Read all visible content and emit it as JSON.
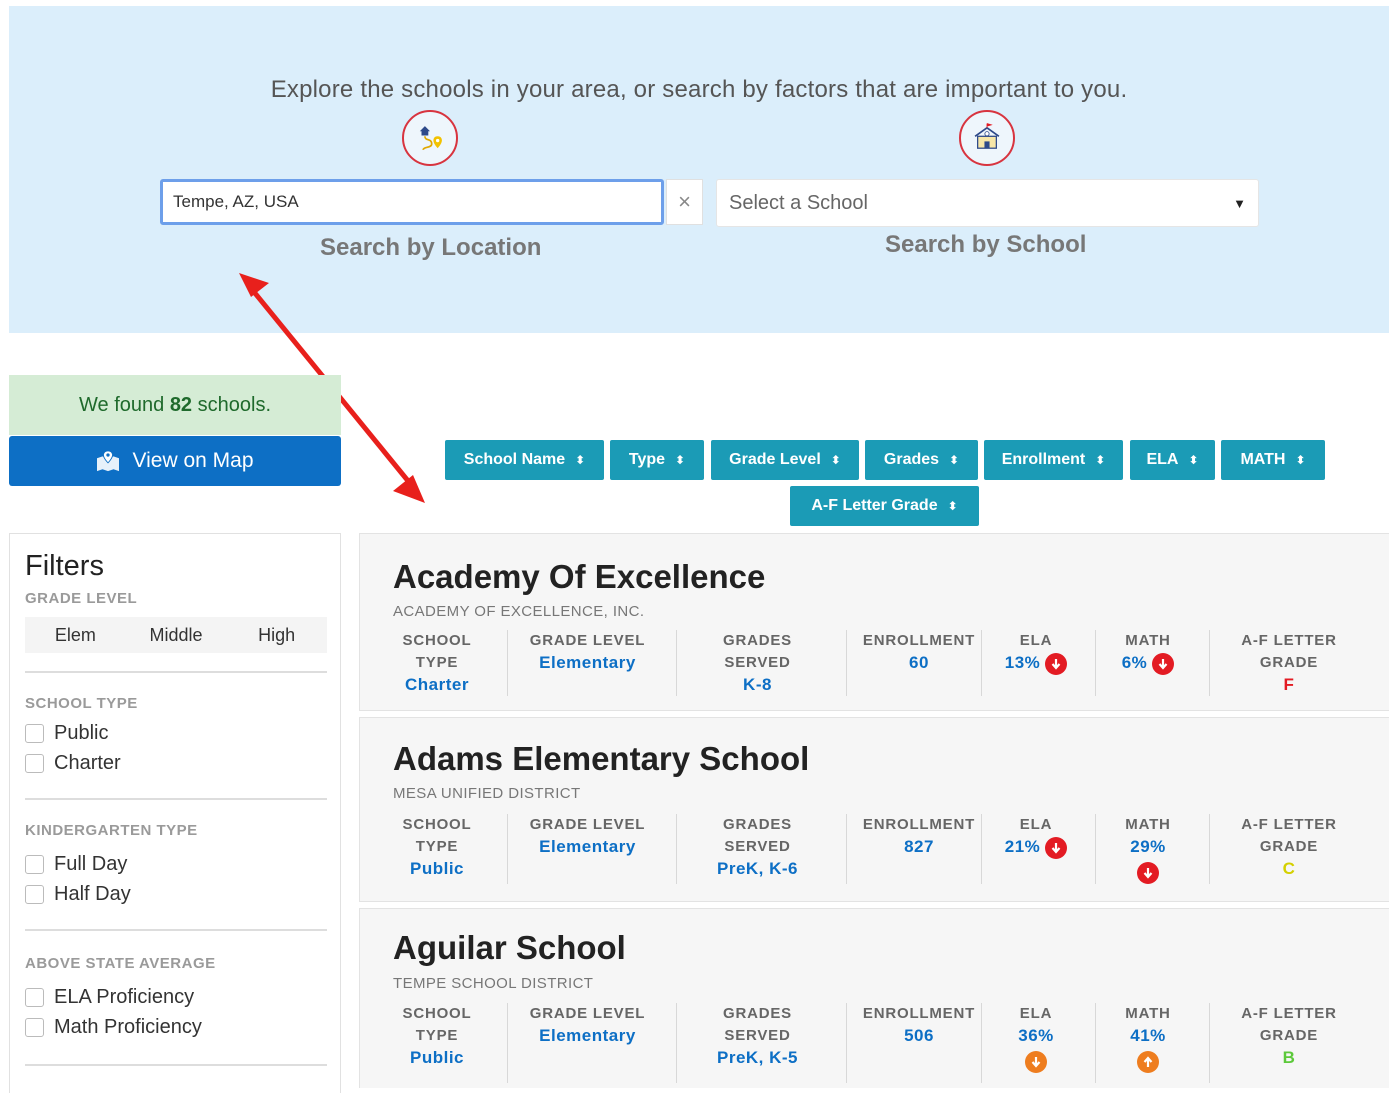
{
  "hero": {
    "title": "Explore the schools in your area, or search by factors that are important to you.",
    "location_value": "Tempe, AZ, USA",
    "clear_symbol": "×",
    "school_placeholder": "Select a School",
    "caret": "▼",
    "location_label": "Search by Location",
    "school_label": "Search by School"
  },
  "results": {
    "found_prefix": "We found",
    "found_count": "82",
    "found_suffix": "schools.",
    "map_button": "View on Map"
  },
  "sort_buttons": [
    "School Name",
    "Type",
    "Grade Level",
    "Grades",
    "Enrollment",
    "ELA",
    "MATH",
    "A-F Letter Grade"
  ],
  "filters": {
    "title": "Filters",
    "grade_level": {
      "title": "GRADE LEVEL",
      "options": [
        "Elem",
        "Middle",
        "High"
      ]
    },
    "school_type": {
      "title": "SCHOOL TYPE",
      "options": [
        "Public",
        "Charter"
      ]
    },
    "kindergarten_type": {
      "title": "KINDERGARTEN TYPE",
      "options": [
        "Full Day",
        "Half Day"
      ]
    },
    "above_state_average": {
      "title": "ABOVE STATE AVERAGE",
      "options": [
        "ELA Proficiency",
        "Math Proficiency"
      ]
    }
  },
  "labels": {
    "school_type_1": "SCHOOL",
    "school_type_2": "TYPE",
    "grade_level": "GRADE LEVEL",
    "grades_served_1": "GRADES",
    "grades_served_2": "SERVED",
    "enrollment": "ENROLLMENT",
    "ela": "ELA",
    "math": "MATH",
    "letter_grade_1": "A-F LETTER",
    "letter_grade_2": "GRADE"
  },
  "schools": [
    {
      "name": "Academy Of Excellence",
      "district": "ACADEMY OF EXCELLENCE, INC.",
      "type": "Charter",
      "grade_level": "Elementary",
      "grades_served": "K-8",
      "enrollment": "60",
      "ela": "13%",
      "ela_trend": "down",
      "math": "6%",
      "math_trend": "down",
      "letter_grade": "F",
      "letter_color": "#e31b23"
    },
    {
      "name": "Adams Elementary School",
      "district": "MESA UNIFIED DISTRICT",
      "type": "Public",
      "grade_level": "Elementary",
      "grades_served": "PreK, K-6",
      "enrollment": "827",
      "ela": "21%",
      "ela_trend": "down",
      "math": "29%",
      "math_trend": "down",
      "letter_grade": "C",
      "letter_color": "#d4d000"
    },
    {
      "name": "Aguilar School",
      "district": "TEMPE SCHOOL DISTRICT",
      "type": "Public",
      "grade_level": "Elementary",
      "grades_served": "PreK, K-5",
      "enrollment": "506",
      "ela": "36%",
      "ela_trend": "down",
      "math": "41%",
      "math_trend": "up",
      "letter_grade": "B",
      "letter_color": "#5cc93a"
    }
  ],
  "colors": {
    "hero_bg": "#dbeefb",
    "primary_blue": "#0d6fc5",
    "sort_teal": "#1b9bb6",
    "found_green_bg": "#d5ecd5",
    "trend_red": "#e31b23",
    "trend_orange": "#ee7d1f",
    "arrow_red": "#e8201c"
  },
  "icons": {
    "location_search": "house-route-pin-icon",
    "school_search": "school-building-icon",
    "map": "map-marker-icon",
    "sort": "sort-icon",
    "trend_down": "arrow-circle-down-icon",
    "trend_up": "arrow-circle-up-icon"
  }
}
